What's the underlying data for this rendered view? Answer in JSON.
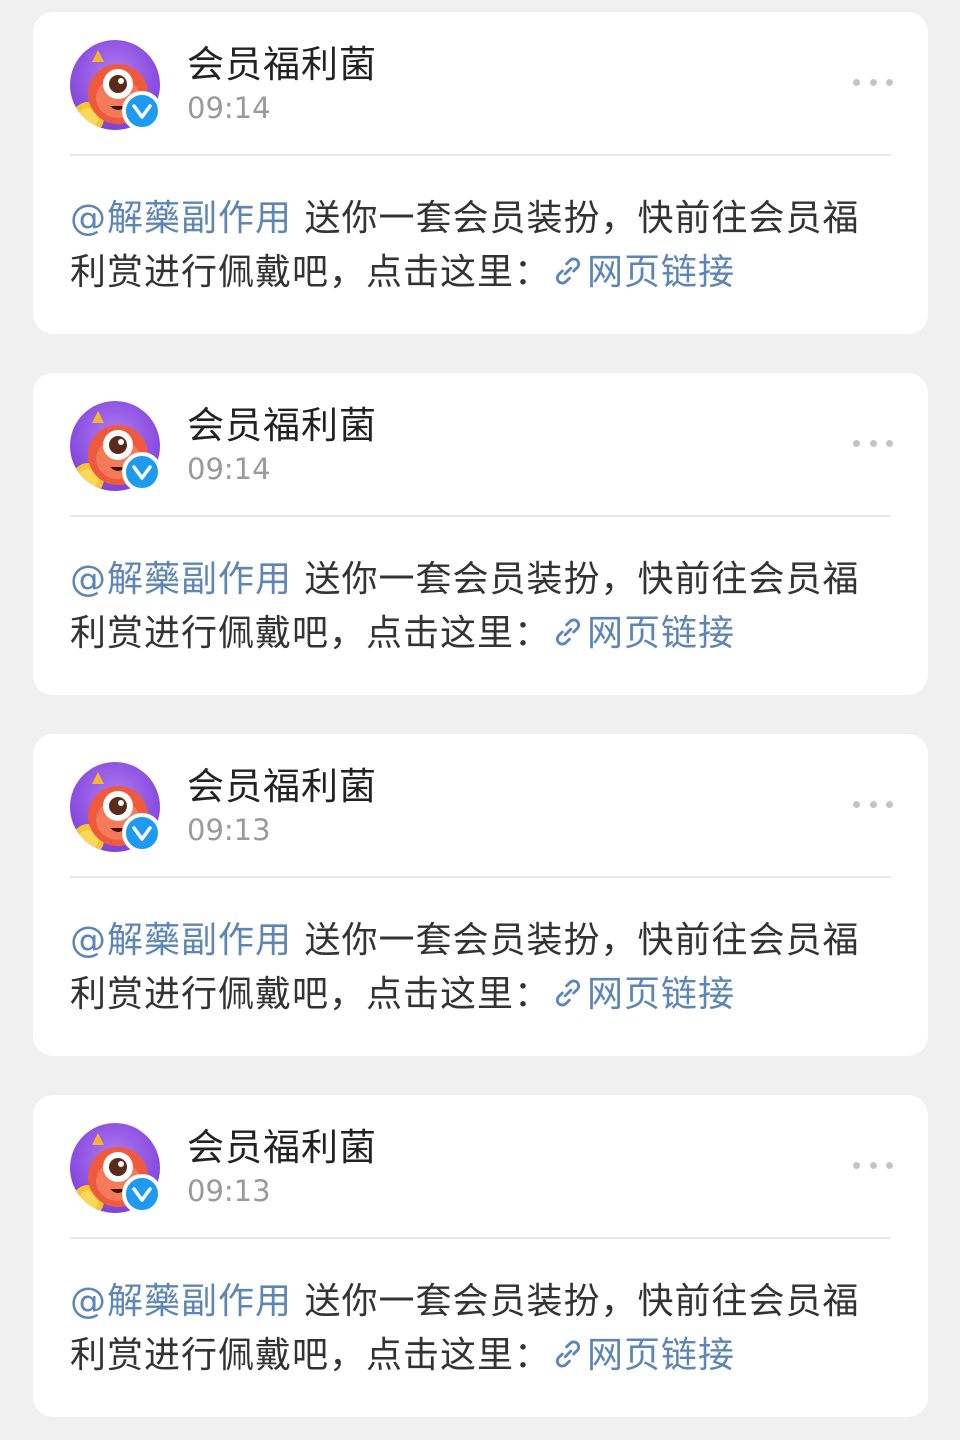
{
  "posts": [
    {
      "author": "会员福利菌",
      "time": "09:14",
      "mention": "@解藥副作用",
      "text_before": " 送你一套会员装扮，快前往会员福利赏进行佩戴吧，点击这里：",
      "link_text": "网页链接",
      "link_icon": "link-icon"
    },
    {
      "author": "会员福利菌",
      "time": "09:14",
      "mention": "@解藥副作用",
      "text_before": " 送你一套会员装扮，快前往会员福利赏进行佩戴吧，点击这里：",
      "link_text": "网页链接",
      "link_icon": "link-icon"
    },
    {
      "author": "会员福利菌",
      "time": "09:13",
      "mention": "@解藥副作用",
      "text_before": " 送你一套会员装扮，快前往会员福利赏进行佩戴吧，点击这里：",
      "link_text": "网页链接",
      "link_icon": "link-icon"
    },
    {
      "author": "会员福利菌",
      "time": "09:13",
      "mention": "@解藥副作用",
      "text_before": " 送你一套会员装扮，快前往会员福利赏进行佩戴吧，点击这里：",
      "link_text": "网页链接",
      "link_icon": "link-icon"
    }
  ],
  "colors": {
    "link": "#5d86b5",
    "verified_badge": "#1e9bf0",
    "avatar_bg": "#8a4ee0",
    "background": "#f0f0f0"
  }
}
